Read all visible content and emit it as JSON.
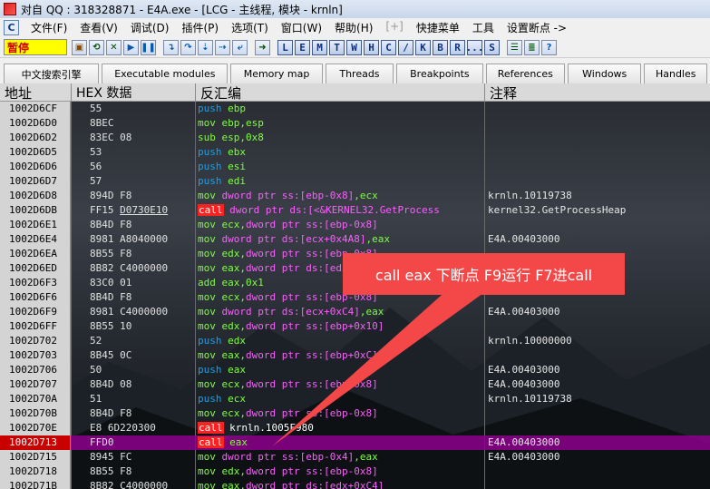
{
  "window": {
    "title": "对自 QQ : 318328871 - E4A.exe - [LCG - 主线程, 模块 - krnln]"
  },
  "menu": {
    "cpu_label": "C",
    "items": [
      {
        "label": "文件(F)",
        "disabled": false
      },
      {
        "label": "查看(V)",
        "disabled": false
      },
      {
        "label": "调试(D)",
        "disabled": false
      },
      {
        "label": "插件(P)",
        "disabled": false
      },
      {
        "label": "选项(T)",
        "disabled": false
      },
      {
        "label": "窗口(W)",
        "disabled": false
      },
      {
        "label": "帮助(H)",
        "disabled": false
      },
      {
        "label": "[+]",
        "disabled": true
      },
      {
        "label": "快捷菜单",
        "disabled": false
      },
      {
        "label": "工具",
        "disabled": false
      },
      {
        "label": "设置断点 ->",
        "disabled": false
      }
    ]
  },
  "toolbar": {
    "status": "暂停",
    "letters": [
      "L",
      "E",
      "M",
      "T",
      "W",
      "H",
      "C",
      "/",
      "K",
      "B",
      "R",
      "...",
      "S"
    ]
  },
  "tabs": [
    {
      "label": "中文搜索引擎",
      "width": 106
    },
    {
      "label": "Executable modules",
      "width": 140
    },
    {
      "label": "Memory map",
      "width": 102
    },
    {
      "label": "Threads",
      "width": 76
    },
    {
      "label": "Breakpoints",
      "width": 96
    },
    {
      "label": "References",
      "width": 88
    },
    {
      "label": "Windows",
      "width": 82
    },
    {
      "label": "Handles",
      "width": 70
    }
  ],
  "columns": {
    "address": "地址",
    "hex": "HEX 数据",
    "disasm": "反汇编",
    "comment": "注释"
  },
  "rows": [
    {
      "addr": "1002D6CF",
      "hex": "55",
      "mn": "push",
      "ops": [
        [
          "reg",
          "ebp"
        ]
      ],
      "cmt": ""
    },
    {
      "addr": "1002D6D0",
      "hex": "8BEC",
      "mn": "mov",
      "ops": [
        [
          "reg",
          "ebp,esp"
        ]
      ],
      "cmt": ""
    },
    {
      "addr": "1002D6D2",
      "hex": "83EC 08",
      "mn": "sub",
      "ops": [
        [
          "reg",
          "esp,"
        ],
        [
          "num",
          "0x8"
        ]
      ],
      "cmt": ""
    },
    {
      "addr": "1002D6D5",
      "hex": "53",
      "mn": "push",
      "ops": [
        [
          "reg",
          "ebx"
        ]
      ],
      "cmt": ""
    },
    {
      "addr": "1002D6D6",
      "hex": "56",
      "mn": "push",
      "ops": [
        [
          "reg",
          "esi"
        ]
      ],
      "cmt": ""
    },
    {
      "addr": "1002D6D7",
      "hex": "57",
      "mn": "push",
      "ops": [
        [
          "reg",
          "edi"
        ]
      ],
      "cmt": ""
    },
    {
      "addr": "1002D6D8",
      "hex": "894D F8",
      "mn": "mov",
      "ops": [
        [
          "mem",
          "dword ptr ss:[ebp-0x8]"
        ],
        [
          "reg",
          ",ecx"
        ]
      ],
      "cmt": "krnln.10119738"
    },
    {
      "addr": "1002D6DB",
      "hex": "FF15 D0730E10",
      "mn": "call",
      "ops": [
        [
          "mem",
          "dword ptr ds:[<&KERNEL32.GetProcess"
        ]
      ],
      "cmt": "kernel32.GetProcessHeap"
    },
    {
      "addr": "1002D6E1",
      "hex": "8B4D F8",
      "mn": "mov",
      "ops": [
        [
          "reg",
          "ecx,"
        ],
        [
          "mem",
          "dword ptr ss:[ebp-0x8]"
        ]
      ],
      "cmt": ""
    },
    {
      "addr": "1002D6E4",
      "hex": "8981 A8040000",
      "mn": "mov",
      "ops": [
        [
          "mem",
          "dword ptr ds:[ecx+0x4A8]"
        ],
        [
          "reg",
          ",eax"
        ]
      ],
      "cmt": "E4A.00403000"
    },
    {
      "addr": "1002D6EA",
      "hex": "8B55 F8",
      "mn": "mov",
      "ops": [
        [
          "reg",
          "edx,"
        ],
        [
          "mem",
          "dword ptr ss:[ebp-0x8]"
        ]
      ],
      "cmt": ""
    },
    {
      "addr": "1002D6ED",
      "hex": "8B82 C4000000",
      "mn": "mov",
      "ops": [
        [
          "reg",
          "eax,"
        ],
        [
          "mem",
          "dword ptr ds:[edx+0xC4]"
        ]
      ],
      "cmt": ""
    },
    {
      "addr": "1002D6F3",
      "hex": "83C0 01",
      "mn": "add",
      "ops": [
        [
          "reg",
          "eax,"
        ],
        [
          "num",
          "0x1"
        ]
      ],
      "cmt": ""
    },
    {
      "addr": "1002D6F6",
      "hex": "8B4D F8",
      "mn": "mov",
      "ops": [
        [
          "reg",
          "ecx,"
        ],
        [
          "mem",
          "dword ptr ss:[ebp-0x8]"
        ]
      ],
      "cmt": ""
    },
    {
      "addr": "1002D6F9",
      "hex": "8981 C4000000",
      "mn": "mov",
      "ops": [
        [
          "mem",
          "dword ptr ds:[ecx+0xC4]"
        ],
        [
          "reg",
          ",eax"
        ]
      ],
      "cmt": "E4A.00403000"
    },
    {
      "addr": "1002D6FF",
      "hex": "8B55 10",
      "mn": "mov",
      "ops": [
        [
          "reg",
          "edx,"
        ],
        [
          "mem",
          "dword ptr ss:[ebp+0x10]"
        ]
      ],
      "cmt": ""
    },
    {
      "addr": "1002D702",
      "hex": "52",
      "mn": "push",
      "ops": [
        [
          "reg",
          "edx"
        ]
      ],
      "cmt": "krnln.10000000"
    },
    {
      "addr": "1002D703",
      "hex": "8B45 0C",
      "mn": "mov",
      "ops": [
        [
          "reg",
          "eax,"
        ],
        [
          "mem",
          "dword ptr ss:[ebp+0xC]"
        ]
      ],
      "cmt": ""
    },
    {
      "addr": "1002D706",
      "hex": "50",
      "mn": "push",
      "ops": [
        [
          "reg",
          "eax"
        ]
      ],
      "cmt": "E4A.00403000"
    },
    {
      "addr": "1002D707",
      "hex": "8B4D 08",
      "mn": "mov",
      "ops": [
        [
          "reg",
          "ecx,"
        ],
        [
          "mem",
          "dword ptr ss:[ebp+0x8]"
        ]
      ],
      "cmt": "E4A.00403000"
    },
    {
      "addr": "1002D70A",
      "hex": "51",
      "mn": "push",
      "ops": [
        [
          "reg",
          "ecx"
        ]
      ],
      "cmt": "krnln.10119738"
    },
    {
      "addr": "1002D70B",
      "hex": "8B4D F8",
      "mn": "mov",
      "ops": [
        [
          "reg",
          "ecx,"
        ],
        [
          "mem",
          "dword ptr ss:[ebp-0x8]"
        ]
      ],
      "cmt": ""
    },
    {
      "addr": "1002D70E",
      "hex": "E8 6D220300",
      "mn": "call",
      "ops": [
        [
          "txt",
          "krnln.1005F980"
        ]
      ],
      "cmt": ""
    },
    {
      "addr": "1002D713",
      "hex": "FFD0",
      "mn": "call",
      "ops": [
        [
          "reg",
          "eax"
        ]
      ],
      "cmt": "E4A.00403000",
      "selected": true
    },
    {
      "addr": "1002D715",
      "hex": "8945 FC",
      "mn": "mov",
      "ops": [
        [
          "mem",
          "dword ptr ss:[ebp-0x4]"
        ],
        [
          "reg",
          ",eax"
        ]
      ],
      "cmt": "E4A.00403000"
    },
    {
      "addr": "1002D718",
      "hex": "8B55 F8",
      "mn": "mov",
      "ops": [
        [
          "reg",
          "edx,"
        ],
        [
          "mem",
          "dword ptr ss:[ebp-0x8]"
        ]
      ],
      "cmt": ""
    },
    {
      "addr": "1002D71B",
      "hex": "8B82 C4000000",
      "mn": "mov",
      "ops": [
        [
          "reg",
          "eax,"
        ],
        [
          "mem",
          "dword ptr ds:[edx+0xC4]"
        ]
      ],
      "cmt": ""
    }
  ],
  "callout": {
    "text": "call eax 下断点 F9运行 F7进call",
    "color": "#f44848"
  }
}
